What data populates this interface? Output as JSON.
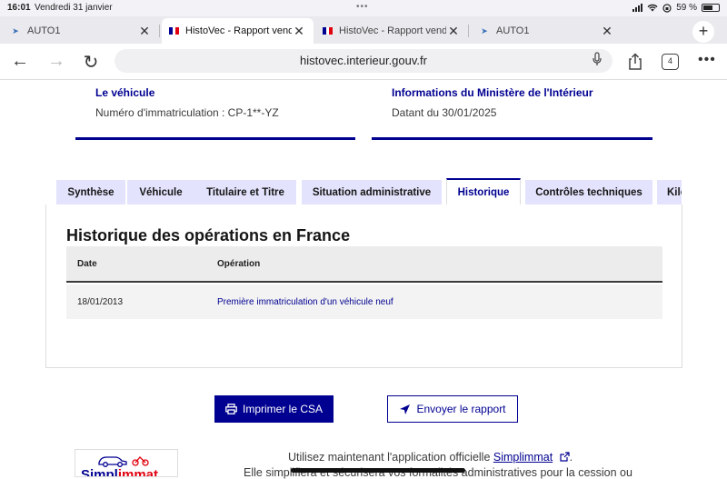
{
  "status_bar": {
    "time": "16:01",
    "date": "Vendredi 31 janvier",
    "battery": "59 %"
  },
  "browser": {
    "tabs": [
      {
        "label": "AUTO1",
        "favicon": "auto1-icon",
        "active": false
      },
      {
        "label": "HistoVec - Rapport vendeur",
        "favicon": "french-flag-icon",
        "active": true
      },
      {
        "label": "HistoVec - Rapport vendeur",
        "favicon": "french-flag-icon",
        "active": false
      },
      {
        "label": "AUTO1",
        "favicon": "auto1-icon",
        "active": false
      }
    ],
    "url": "histovec.interieur.gouv.fr",
    "tab_count": "4"
  },
  "cards": {
    "vehicle": {
      "title": "Le véhicule",
      "text": "Numéro d'immatriculation : CP-1**-YZ"
    },
    "ministry": {
      "title": "Informations du Ministère de l'Intérieur",
      "text": "Datant du 30/01/2025"
    }
  },
  "page_tabs": [
    "Synthèse",
    "Véhicule",
    "Titulaire et Titre",
    "Situation administrative",
    "Historique",
    "Contrôles techniques",
    "Kilo"
  ],
  "history": {
    "title": "Historique des opérations en France",
    "columns": [
      "Date",
      "Opération"
    ],
    "rows": [
      {
        "date": "18/01/2013",
        "operation": "Première immatriculation d'un véhicule neuf"
      }
    ]
  },
  "actions": {
    "print": "Imprimer le CSA",
    "send": "Envoyer le rapport"
  },
  "promo": {
    "logo_text": "Simplimmat",
    "line1_prefix": "Utilisez maintenant l'application officielle ",
    "line1_link": "Simplimmat",
    "line2": "Elle simplifiera et sécurisera vos formalités administratives pour la cession ou"
  },
  "colors": {
    "primary": "#000091",
    "tab_bg": "#e3e3fd",
    "accent_red": "#e1000f"
  }
}
